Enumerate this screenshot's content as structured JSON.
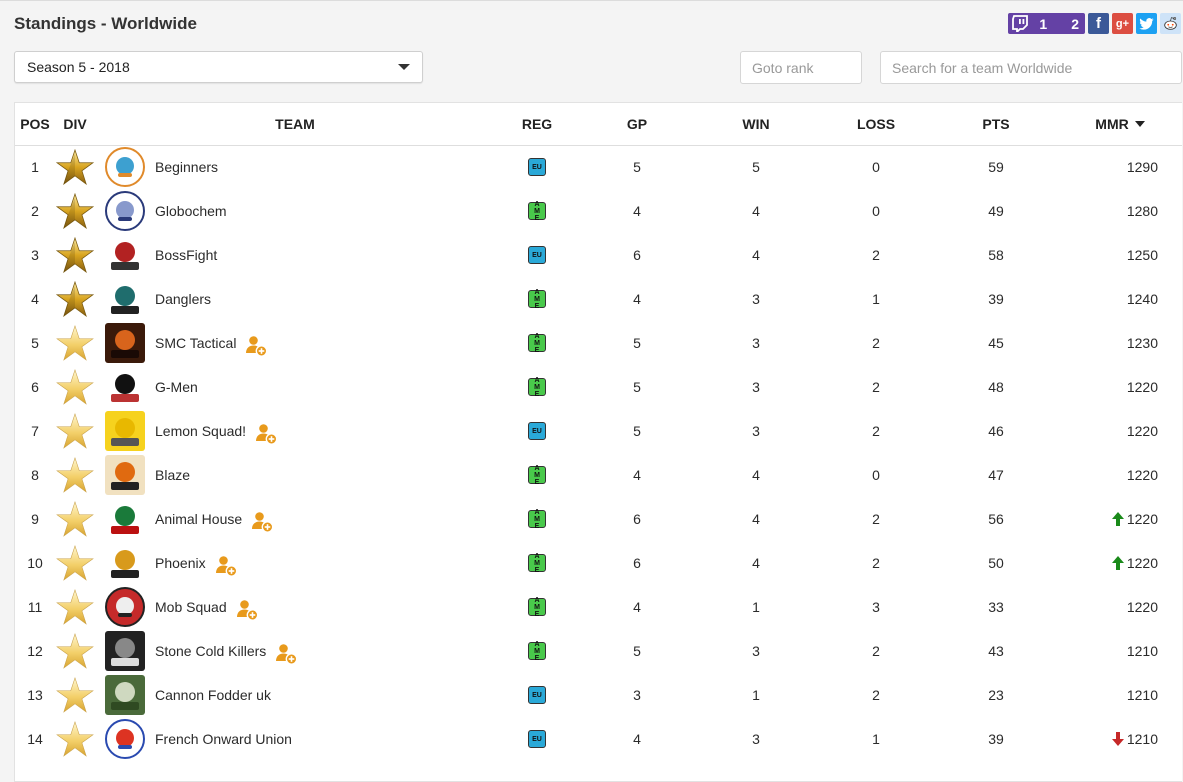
{
  "page": {
    "title": "Standings - Worldwide"
  },
  "social": {
    "twitch_count_1": "1",
    "twitch_count_2": "2",
    "facebook": "f",
    "googleplus": "g+",
    "twitter": "t",
    "reddit": "r"
  },
  "filters": {
    "season_selected": "Season 5 - 2018",
    "goto_rank_placeholder": "Goto rank",
    "search_placeholder": "Search for a team Worldwide"
  },
  "table": {
    "headers": {
      "pos": "POS",
      "div": "DIV",
      "team": "TEAM",
      "reg": "REG",
      "gp": "GP",
      "win": "WIN",
      "loss": "LOSS",
      "pts": "PTS",
      "mmr": "MMR"
    },
    "rows": [
      {
        "pos": "1",
        "team": "Beginners",
        "reg": "EU",
        "gp": "5",
        "win": "5",
        "loss": "0",
        "pts": "59",
        "mmr": "1290",
        "division": "gold-star",
        "recruiting": false,
        "trend": "none"
      },
      {
        "pos": "2",
        "team": "Globochem",
        "reg": "AME",
        "gp": "4",
        "win": "4",
        "loss": "0",
        "pts": "49",
        "mmr": "1280",
        "division": "gold-star",
        "recruiting": false,
        "trend": "none"
      },
      {
        "pos": "3",
        "team": "BossFight",
        "reg": "EU",
        "gp": "6",
        "win": "4",
        "loss": "2",
        "pts": "58",
        "mmr": "1250",
        "division": "gold-star",
        "recruiting": false,
        "trend": "none"
      },
      {
        "pos": "4",
        "team": "Danglers",
        "reg": "AME",
        "gp": "4",
        "win": "3",
        "loss": "1",
        "pts": "39",
        "mmr": "1240",
        "division": "gold-star",
        "recruiting": false,
        "trend": "none"
      },
      {
        "pos": "5",
        "team": "SMC Tactical",
        "reg": "AME",
        "gp": "5",
        "win": "3",
        "loss": "2",
        "pts": "45",
        "mmr": "1230",
        "division": "light-star",
        "recruiting": true,
        "trend": "none"
      },
      {
        "pos": "6",
        "team": "G-Men",
        "reg": "AME",
        "gp": "5",
        "win": "3",
        "loss": "2",
        "pts": "48",
        "mmr": "1220",
        "division": "light-star",
        "recruiting": false,
        "trend": "none"
      },
      {
        "pos": "7",
        "team": "Lemon Squad!",
        "reg": "EU",
        "gp": "5",
        "win": "3",
        "loss": "2",
        "pts": "46",
        "mmr": "1220",
        "division": "light-star",
        "recruiting": true,
        "trend": "none"
      },
      {
        "pos": "8",
        "team": "Blaze",
        "reg": "AME",
        "gp": "4",
        "win": "4",
        "loss": "0",
        "pts": "47",
        "mmr": "1220",
        "division": "light-star",
        "recruiting": false,
        "trend": "none"
      },
      {
        "pos": "9",
        "team": "Animal House",
        "reg": "AME",
        "gp": "6",
        "win": "4",
        "loss": "2",
        "pts": "56",
        "mmr": "1220",
        "division": "light-star",
        "recruiting": true,
        "trend": "up"
      },
      {
        "pos": "10",
        "team": "Phoenix",
        "reg": "AME",
        "gp": "6",
        "win": "4",
        "loss": "2",
        "pts": "50",
        "mmr": "1220",
        "division": "light-star",
        "recruiting": true,
        "trend": "up"
      },
      {
        "pos": "11",
        "team": "Mob Squad",
        "reg": "AME",
        "gp": "4",
        "win": "1",
        "loss": "3",
        "pts": "33",
        "mmr": "1220",
        "division": "light-star",
        "recruiting": true,
        "trend": "none"
      },
      {
        "pos": "12",
        "team": "Stone Cold Killers",
        "reg": "AME",
        "gp": "5",
        "win": "3",
        "loss": "2",
        "pts": "43",
        "mmr": "1210",
        "division": "light-star",
        "recruiting": true,
        "trend": "none"
      },
      {
        "pos": "13",
        "team": "Cannon Fodder uk",
        "reg": "EU",
        "gp": "3",
        "win": "1",
        "loss": "2",
        "pts": "23",
        "mmr": "1210",
        "division": "light-star",
        "recruiting": false,
        "trend": "none"
      },
      {
        "pos": "14",
        "team": "French Onward Union",
        "reg": "EU",
        "gp": "4",
        "win": "3",
        "loss": "1",
        "pts": "39",
        "mmr": "1210",
        "division": "light-star",
        "recruiting": false,
        "trend": "down"
      }
    ]
  },
  "colors": {
    "trend_up": "#1a8a1a",
    "trend_down": "#c62828",
    "region_eu": "#2aa9d8",
    "region_ame": "#49c94b",
    "recruit_icon": "#e89a1c",
    "twitch": "#6441a5"
  }
}
